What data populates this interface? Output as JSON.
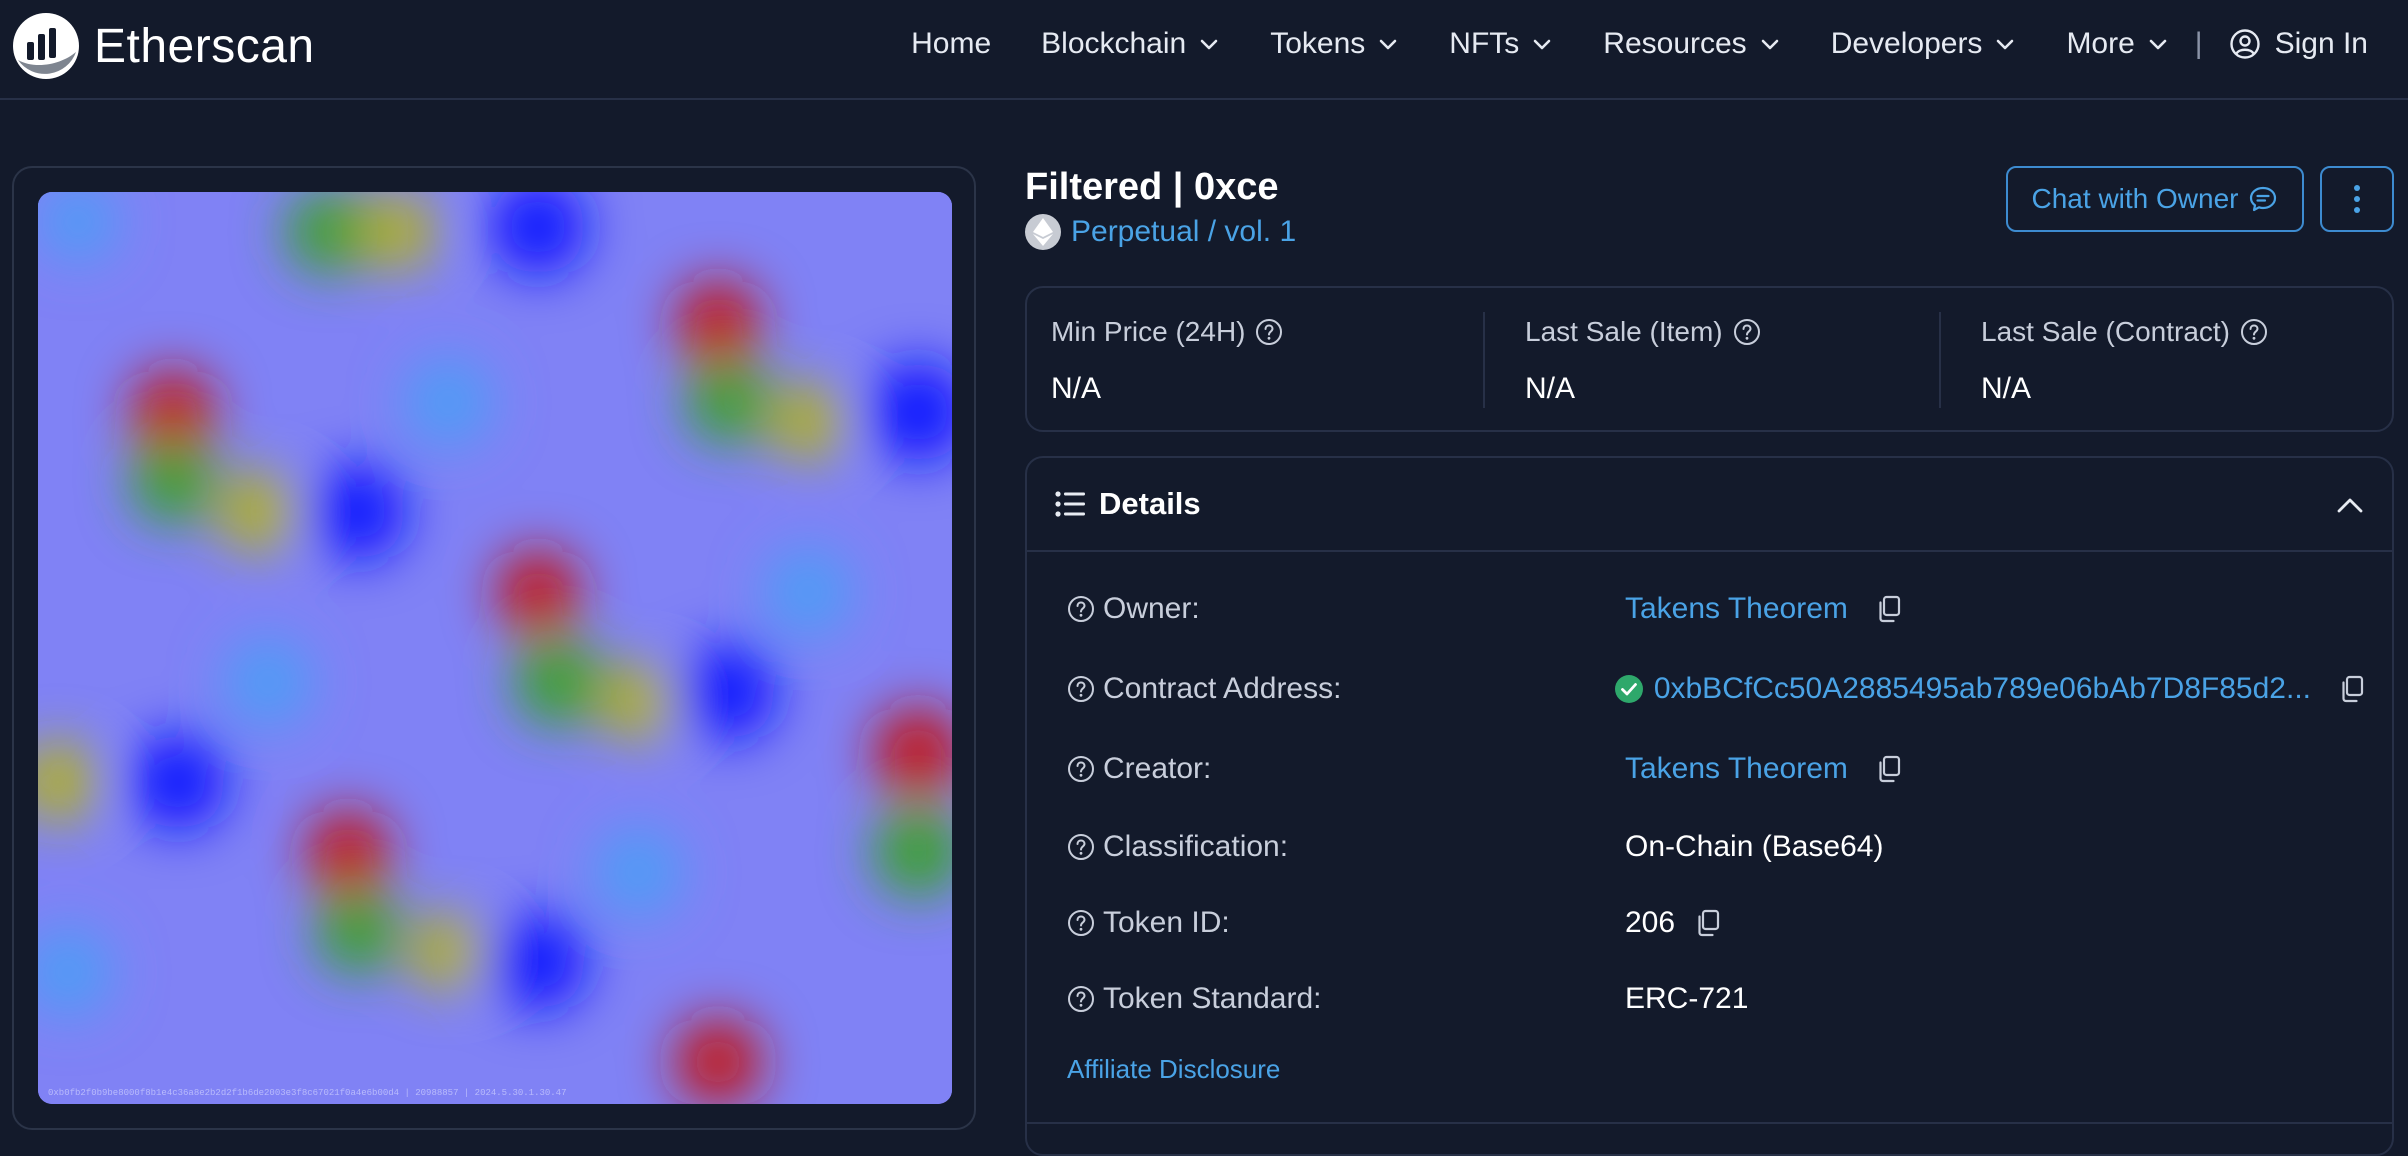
{
  "header": {
    "logo_text": "Etherscan",
    "nav": [
      {
        "label": "Home",
        "has_dropdown": false
      },
      {
        "label": "Blockchain",
        "has_dropdown": true
      },
      {
        "label": "Tokens",
        "has_dropdown": true
      },
      {
        "label": "NFTs",
        "has_dropdown": true
      },
      {
        "label": "Resources",
        "has_dropdown": true
      },
      {
        "label": "Developers",
        "has_dropdown": true
      },
      {
        "label": "More",
        "has_dropdown": true
      }
    ],
    "separator": "|",
    "sign_in": "Sign In"
  },
  "nft": {
    "title": "Filtered | 0xce",
    "collection": "Perpetual / vol. 1",
    "image_caption": "0xb0fb2f0b9be8000f8b1e4c36a8e2b2d2f1b6de2003e3f8c67021f0a4e6b00d4 | 20988857 | 2024.5.30.1.30.47"
  },
  "actions": {
    "chat_label": "Chat with Owner"
  },
  "stats": [
    {
      "label": "Min Price (24H)",
      "value": "N/A"
    },
    {
      "label": "Last Sale (Item)",
      "value": "N/A"
    },
    {
      "label": "Last Sale (Contract)",
      "value": "N/A"
    }
  ],
  "details": {
    "title": "Details",
    "rows": {
      "owner": {
        "label": "Owner:",
        "value": "Takens Theorem"
      },
      "contract": {
        "label": "Contract Address:",
        "value": "0xbBCfCc50A2885495ab789e06bAb7D8F85d2..."
      },
      "creator": {
        "label": "Creator:",
        "value": "Takens Theorem"
      },
      "classification": {
        "label": "Classification:",
        "value": "On-Chain (Base64)"
      },
      "token_id": {
        "label": "Token ID:",
        "value": "206"
      },
      "token_standard": {
        "label": "Token Standard:",
        "value": "ERC-721"
      }
    },
    "affiliate": "Affiliate Disclosure"
  },
  "colors": {
    "background": "#131a2b",
    "accent_link": "#4aa3e6",
    "border": "#273047",
    "art_background": "#8082f5",
    "verified_green": "#2ea86b"
  },
  "icons": {
    "logo": "etherscan-logo-icon",
    "dropdown": "chevron-down-icon",
    "user": "user-circle-icon",
    "ethereum": "ethereum-icon",
    "chat": "chat-bubble-icon",
    "more": "vertical-dots-icon",
    "help": "question-circle-icon",
    "details": "list-icon",
    "collapse": "chevron-up-icon",
    "copy": "copy-icon",
    "verified": "check-circle-icon"
  }
}
